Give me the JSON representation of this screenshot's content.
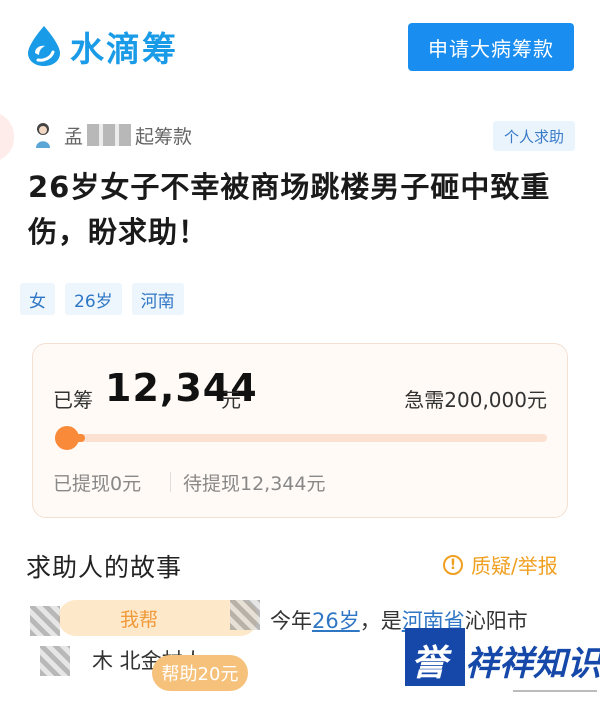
{
  "header": {
    "logo_text": "水滴筹",
    "apply_button": "申请大病筹款",
    "brand_color": "#1a8ef0"
  },
  "initiator": {
    "name_prefix": "孟",
    "name_suffix": "起筹款",
    "type_tag": "个人求助"
  },
  "campaign": {
    "title": "26岁女子不幸被商场跳楼男子砸中致重伤，盼求助！",
    "tags": [
      "女",
      "26岁",
      "河南"
    ]
  },
  "fund": {
    "raised_label": "已筹",
    "raised_amount": "12,344",
    "raised_unit": "元",
    "target_text": "急需200,000元",
    "progress_fraction": 0.0617,
    "withdrawn_text": "已提现0元",
    "pending_text": "待提现12,344元",
    "accent_color": "#f98a3a"
  },
  "story": {
    "heading": "求助人的故事",
    "report_label": "质疑/举报",
    "line1_intro": "今年",
    "line1_age": "26岁",
    "line1_mid": "，是",
    "line1_province": "河南省",
    "line1_city": "沁阳市",
    "line2_text": "木  北金村人。",
    "help_bubble_text": "我帮",
    "help_tip_text": "帮助20元"
  },
  "watermark": {
    "first_char": "誉",
    "rest_text": "祥祥知识"
  }
}
